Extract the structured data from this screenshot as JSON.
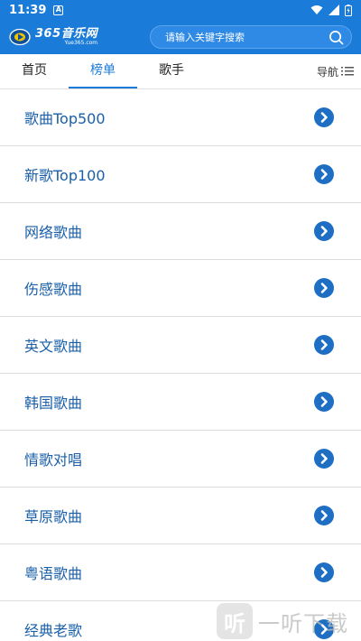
{
  "status_bar": {
    "time": "11:39",
    "a_badge": "A"
  },
  "header": {
    "logo_name": "365音乐网",
    "logo_url": "Yue365.com",
    "search_placeholder": "请输入关键字搜索"
  },
  "tabs": [
    {
      "label": "首页"
    },
    {
      "label": "榜单",
      "active": true
    },
    {
      "label": "歌手"
    }
  ],
  "nav_menu_label": "导航",
  "chart_list": [
    {
      "label": "歌曲Top500"
    },
    {
      "label": "新歌Top100"
    },
    {
      "label": "网络歌曲"
    },
    {
      "label": "伤感歌曲"
    },
    {
      "label": "英文歌曲"
    },
    {
      "label": "韩国歌曲"
    },
    {
      "label": "情歌对唱"
    },
    {
      "label": "草原歌曲"
    },
    {
      "label": "粤语歌曲"
    },
    {
      "label": "经典老歌"
    }
  ],
  "watermark": {
    "badge": "听",
    "text": "一听下载"
  },
  "colors": {
    "brand_blue": "#1a7bd9",
    "item_text": "#1a5fa8",
    "arrow_bg": "#1e6fc4"
  }
}
